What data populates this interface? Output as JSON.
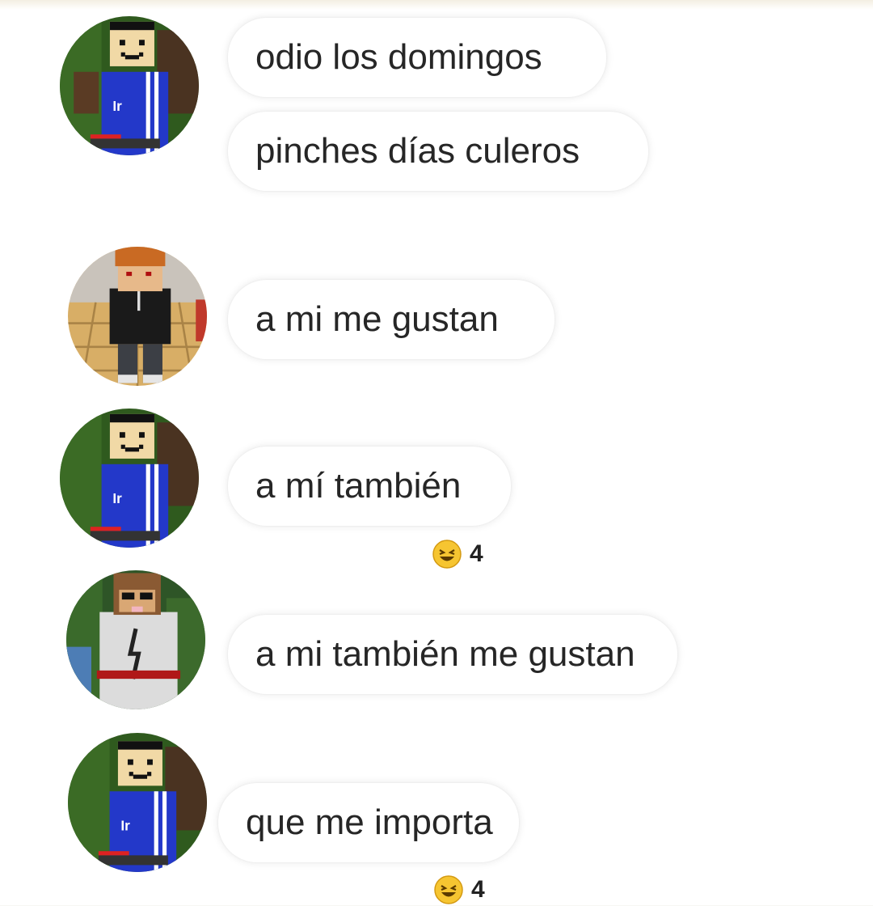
{
  "messages": [
    {
      "avatar": "minecraft-avatar-blue-hoodie",
      "lines": [
        "odio los domingos",
        "pinches días culeros"
      ]
    },
    {
      "avatar": "minecraft-avatar-orange-hair",
      "lines": [
        "a mi me gustan"
      ]
    },
    {
      "avatar": "minecraft-avatar-blue-hoodie",
      "lines": [
        "a mí también"
      ],
      "reaction": {
        "icon": "laughing-emoji-icon",
        "count": "4"
      }
    },
    {
      "avatar": "minecraft-avatar-brown-hair-white-hoodie",
      "lines": [
        "a mi también me gustan"
      ]
    },
    {
      "avatar": "minecraft-avatar-blue-hoodie",
      "lines": [
        "que me importa"
      ],
      "reaction": {
        "icon": "laughing-emoji-icon",
        "count": "4"
      }
    }
  ],
  "colors": {
    "bubble_bg": "#ffffff",
    "text": "#262626",
    "hoodie_blue": "#2338c9",
    "skin": "#f1d9a6"
  }
}
